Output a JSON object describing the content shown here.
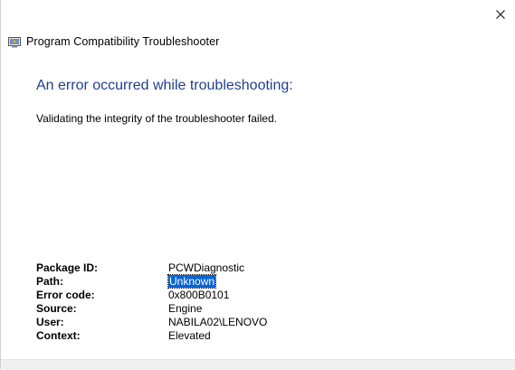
{
  "window": {
    "title": "Program Compatibility Troubleshooter",
    "close_icon": "close-icon",
    "app_icon": "troubleshooter-icon"
  },
  "content": {
    "headline": "An error occurred while troubleshooting:",
    "message": "Validating the integrity of the troubleshooter failed."
  },
  "details": [
    {
      "label": "Package ID:",
      "value": "PCWDiagnostic"
    },
    {
      "label": "Path:",
      "value": "Unknown",
      "selected": true
    },
    {
      "label": "Error code:",
      "value": "0x800B0101"
    },
    {
      "label": "Source:",
      "value": "Engine"
    },
    {
      "label": "User:",
      "value": "NABILA02\\LENOVO"
    },
    {
      "label": "Context:",
      "value": "Elevated"
    }
  ],
  "colors": {
    "headline": "#1f3f8f",
    "selection": "#0a64d2"
  }
}
